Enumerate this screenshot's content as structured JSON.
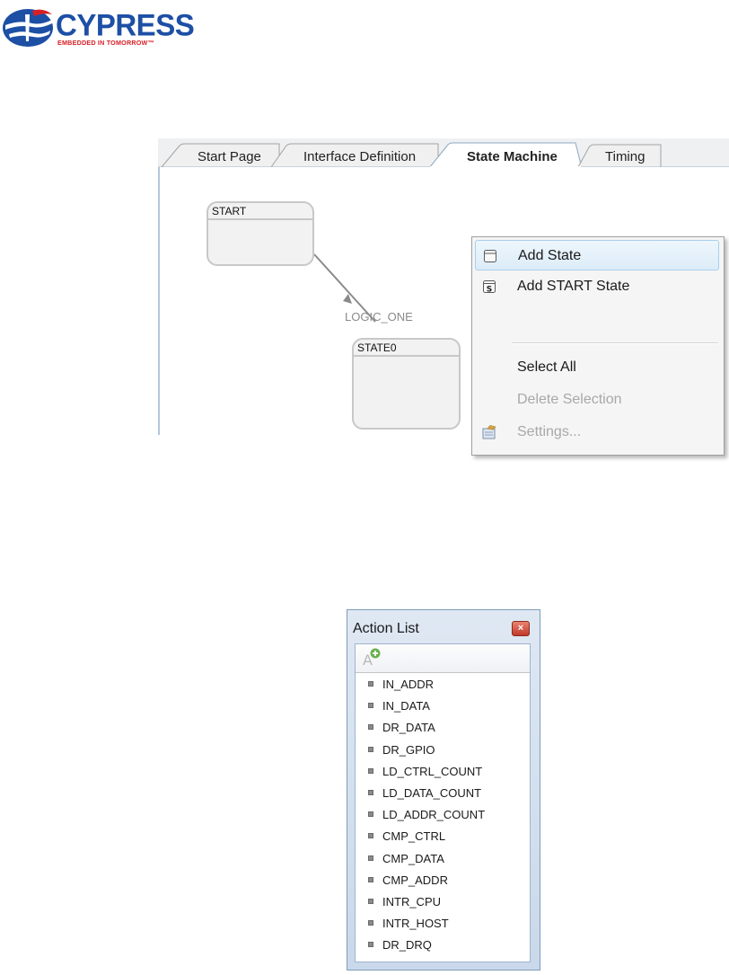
{
  "logo": {
    "wordmark": "CYPRESS",
    "tagline": "EMBEDDED IN TOMORROW™",
    "colors": {
      "brand_blue": "#1d4fa5",
      "brand_red": "#d71f26"
    }
  },
  "editor": {
    "tabs": [
      {
        "label": "Start Page",
        "active": false
      },
      {
        "label": "Interface Definition",
        "active": false
      },
      {
        "label": "State Machine",
        "active": true
      },
      {
        "label": "Timing",
        "active": false
      }
    ],
    "states": [
      {
        "name": "START"
      },
      {
        "name": "STATE0"
      }
    ],
    "transition_label": "LOGIC_ONE",
    "context_menu": {
      "items": [
        {
          "label": "Add State",
          "icon": "state-box-icon",
          "highlighted": true,
          "enabled": true
        },
        {
          "label": "Add START State",
          "icon": "start-state-icon",
          "highlighted": false,
          "enabled": true
        },
        {
          "label": "Select All",
          "icon": "",
          "highlighted": false,
          "enabled": true
        },
        {
          "label": "Delete Selection",
          "icon": "",
          "highlighted": false,
          "enabled": false
        },
        {
          "label": "Settings...",
          "icon": "settings-icon",
          "highlighted": false,
          "enabled": false
        }
      ],
      "highlight_color": "#dcecf8"
    }
  },
  "action_list": {
    "title": "Action List",
    "close_glyph": "×",
    "add_button_icon": "add-action-icon",
    "items": [
      "IN_ADDR",
      "IN_DATA",
      "DR_DATA",
      "DR_GPIO",
      "LD_CTRL_COUNT",
      "LD_DATA_COUNT",
      "LD_ADDR_COUNT",
      "CMP_CTRL",
      "CMP_DATA",
      "CMP_ADDR",
      "INTR_CPU",
      "INTR_HOST",
      "DR_DRQ"
    ]
  }
}
